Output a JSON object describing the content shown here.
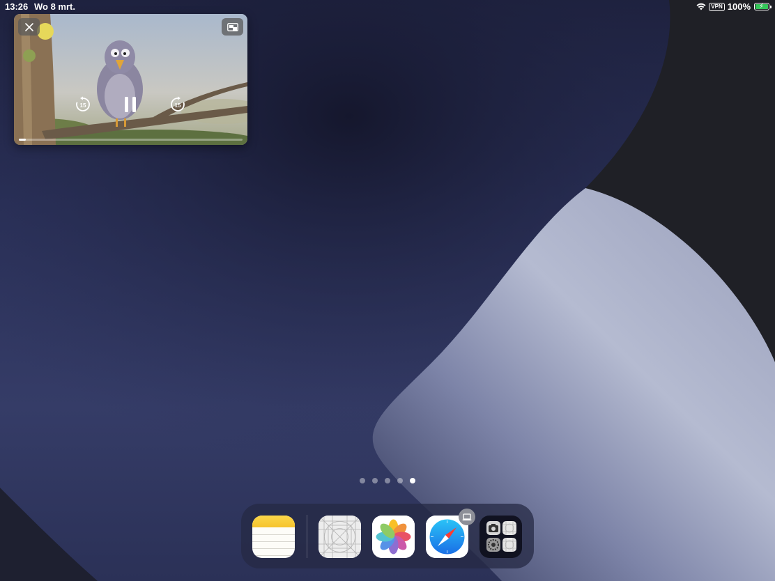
{
  "status_bar": {
    "time": "13:26",
    "date": "Wo 8 mrt.",
    "vpn": "VPN",
    "battery_percent": "100%",
    "battery_level": 1.0,
    "charging": true
  },
  "pip": {
    "close_icon": "close-icon",
    "restore_icon": "pip-restore-icon",
    "skip_back_label": "15",
    "skip_forward_label": "15",
    "pause_icon": "pause-icon",
    "progress": 0.03
  },
  "page_dots": {
    "count": 5,
    "active_index": 4
  },
  "dock": {
    "apps": [
      {
        "name": "notes",
        "icon": "notes-icon"
      },
      {
        "name": "placeholder-app",
        "icon": "app-placeholder-icon"
      },
      {
        "name": "photos",
        "icon": "photos-icon"
      },
      {
        "name": "safari",
        "icon": "safari-icon"
      },
      {
        "name": "folder",
        "icon": "app-folder-icon"
      }
    ],
    "handoff_badge_icon": "laptop-icon"
  },
  "colors": {
    "battery_fill": "#34c759",
    "wallpaper_dark": "#1c1f3a",
    "wallpaper_light": "#aeb4cc"
  }
}
